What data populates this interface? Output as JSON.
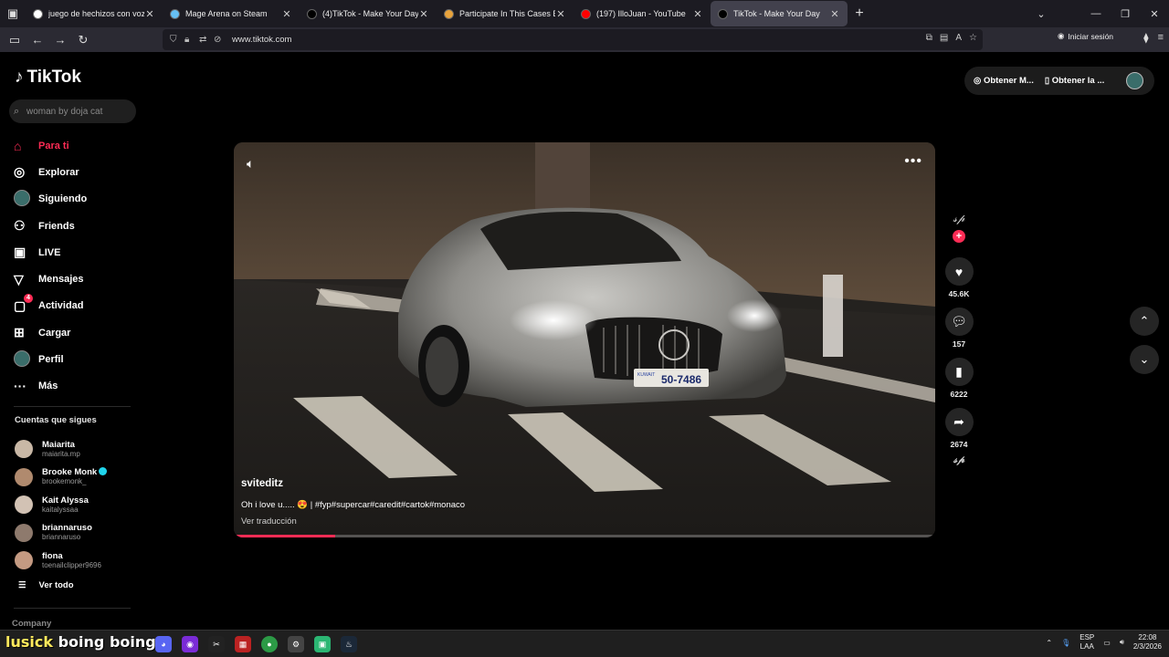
{
  "browser": {
    "tabs": [
      {
        "title": "juego de hechizos con voz - Bu",
        "favicon_color": "#ffffff"
      },
      {
        "title": "Mage Arena on Steam",
        "favicon_color": "#66c0f4"
      },
      {
        "title": "(4)TikTok - Make Your Day",
        "favicon_color": "#000000"
      },
      {
        "title": "Participate In This Cases Battle!",
        "favicon_color": "#e8a33c"
      },
      {
        "title": "(197) IlloJuan - YouTube",
        "favicon_color": "#ff0000"
      },
      {
        "title": "TikTok - Make Your Day",
        "favicon_color": "#000000"
      }
    ],
    "url": "www.tiktok.com",
    "login_label": "Iniciar sesión"
  },
  "tiktok": {
    "brand": "TikTok",
    "search_placeholder": "woman by doja cat",
    "menu": [
      {
        "label": "Para ti",
        "icon": "home-icon",
        "glyph": "⌂",
        "active": true
      },
      {
        "label": "Explorar",
        "icon": "compass-icon",
        "glyph": "◎"
      },
      {
        "label": "Siguiendo",
        "icon": "avatar-icon",
        "glyph": ""
      },
      {
        "label": "Friends",
        "icon": "friends-icon",
        "glyph": "⚇"
      },
      {
        "label": "LIVE",
        "icon": "live-icon",
        "glyph": "▣"
      },
      {
        "label": "Mensajes",
        "icon": "send-icon",
        "glyph": "▽"
      },
      {
        "label": "Actividad",
        "icon": "activity-icon",
        "glyph": "▢",
        "badge": "4"
      },
      {
        "label": "Cargar",
        "icon": "upload-icon",
        "glyph": "⊞"
      },
      {
        "label": "Perfil",
        "icon": "profile-icon",
        "glyph": ""
      },
      {
        "label": "Más",
        "icon": "more-icon",
        "glyph": "···"
      }
    ],
    "following_title": "Cuentas que sigues",
    "following": [
      {
        "name": "Maiarita",
        "user": "maiarita.mp",
        "color": "#c9b8a6"
      },
      {
        "name": "Brooke Monk",
        "user": "brookemonk_",
        "color": "#b08a6e",
        "verified": true
      },
      {
        "name": "Kait Alyssa",
        "user": "kaitalyssaa",
        "color": "#d2c2b4"
      },
      {
        "name": "briannaruso",
        "user": "briannaruso",
        "color": "#8e7a6d"
      },
      {
        "name": "fiona",
        "user": "toenailclipper9696",
        "color": "#c49a82"
      }
    ],
    "see_all": "Ver todo",
    "company": "Company",
    "top_pill": {
      "item1": "Obtener M...",
      "item2": "Obtener la ..."
    },
    "video": {
      "author": "sviteditz",
      "caption": "Oh i love u..... 😍 | #fyp#supercar#caredit#cartok#monaco",
      "translate": "Ver traducción",
      "plate_text": "50-7486",
      "plate_small": "KUWAIT",
      "progress": 0.145
    },
    "actions": {
      "likes": "45.6K",
      "comments": "157",
      "saves": "6222",
      "shares": "2674"
    }
  },
  "taskbar": {
    "sticker_text_1": "lusick",
    "sticker_text_2": "boing boing",
    "lang_top": "ESP",
    "lang_bottom": "LAA",
    "time": "22:08",
    "date": "2/3/2026"
  }
}
